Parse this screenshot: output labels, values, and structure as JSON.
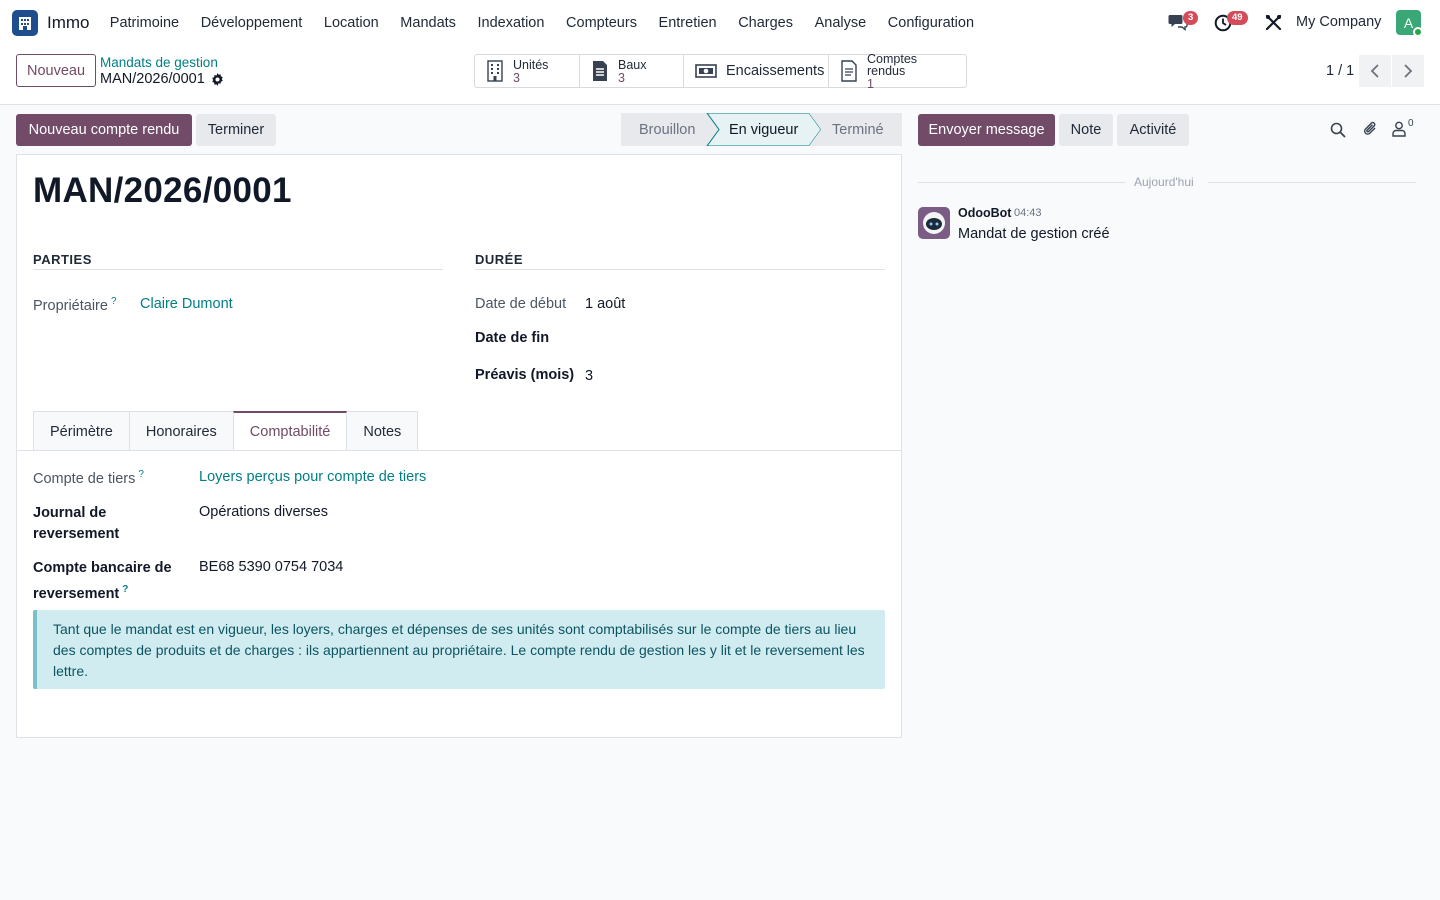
{
  "navbar": {
    "app_name": "Immo",
    "menu": [
      "Patrimoine",
      "Développement",
      "Location",
      "Mandats",
      "Indexation",
      "Compteurs",
      "Entretien",
      "Charges",
      "Analyse",
      "Configuration"
    ],
    "messages_badge": "3",
    "activities_badge": "49",
    "company": "My Company",
    "avatar_letter": "A"
  },
  "control": {
    "new_button": "Nouveau",
    "breadcrumb_parent": "Mandats de gestion",
    "breadcrumb_current": "MAN/2026/0001",
    "stats": [
      {
        "label": "Unités",
        "value": "3",
        "icon": "building-icon"
      },
      {
        "label": "Baux",
        "value": "3",
        "icon": "document-icon"
      },
      {
        "label": "Encaissements",
        "value": "",
        "icon": "money-icon"
      },
      {
        "label": "Comptes rendus",
        "value": "1",
        "icon": "report-icon"
      }
    ],
    "pager": "1 / 1"
  },
  "actions": {
    "new_report": "Nouveau compte rendu",
    "finish": "Terminer"
  },
  "status": {
    "steps": [
      "Brouillon",
      "En vigueur",
      "Terminé"
    ],
    "current": "En vigueur"
  },
  "form": {
    "title": "MAN/2026/0001",
    "parties_heading": "PARTIES",
    "duration_heading": "DURÉE",
    "owner_label": "Propriétaire",
    "owner_value": "Claire Dumont",
    "start_label": "Date de début",
    "start_value": "1 août",
    "end_label": "Date de fin",
    "end_value": "",
    "notice_label": "Préavis (mois)",
    "notice_value": "3",
    "tabs": [
      "Périmètre",
      "Honoraires",
      "Comptabilité",
      "Notes"
    ],
    "active_tab": "Comptabilité",
    "accounting": {
      "third_party_label": "Compte de tiers",
      "third_party_value": "Loyers perçus pour compte de tiers",
      "journal_label_1": "Journal de",
      "journal_label_2": "reversement",
      "journal_value": "Opérations diverses",
      "bank_label_1": "Compte bancaire de",
      "bank_label_2": "reversement",
      "bank_value": "BE68 5390 0754 7034",
      "info": "Tant que le mandat est en vigueur, les loyers, charges et dépenses de ses unités sont comptabilisés sur le compte de tiers au lieu des comptes de produits et de charges : ils appartiennent au propriétaire. Le compte rendu de gestion les y lit et le reversement les lettre."
    }
  },
  "chatter": {
    "send_message": "Envoyer message",
    "note": "Note",
    "activity": "Activité",
    "followers_count": "0",
    "day_label": "Aujourd'hui",
    "author": "OdooBot",
    "time": "04:43",
    "message": "Mandat de gestion créé"
  },
  "colors": {
    "primary": "#714b67",
    "link": "#017e84",
    "badge": "#d44c59",
    "info_bg": "#d1ecf1"
  }
}
